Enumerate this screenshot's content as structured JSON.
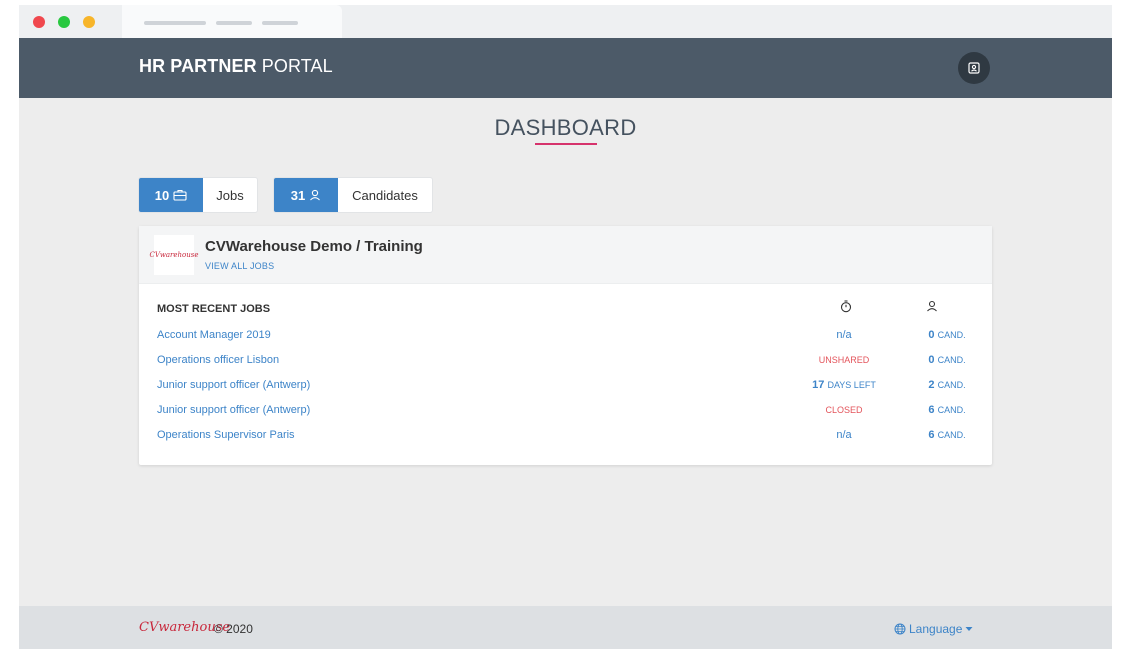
{
  "brand": {
    "bold": "HR PARTNER",
    "rest": " PORTAL"
  },
  "page_title": "DASHBOARD",
  "counters": [
    {
      "value": "10",
      "label": "Jobs",
      "icon": "briefcase-icon"
    },
    {
      "value": "31",
      "label": "Candidates",
      "icon": "user-icon"
    }
  ],
  "company": {
    "name": "CVWarehouse Demo / Training",
    "view_all": "VIEW ALL JOBS",
    "logo_text": "CVwarehouse"
  },
  "jobs": {
    "header": "MOST RECENT JOBS",
    "rows": [
      {
        "title": "Account Manager 2019",
        "status": "n/a",
        "status_type": "na",
        "count": "0",
        "cand_unit": "CAND."
      },
      {
        "title": "Operations officer Lisbon",
        "status": "UNSHARED",
        "status_type": "red",
        "count": "0",
        "cand_unit": "CAND."
      },
      {
        "title": "Junior support officer (Antwerp)",
        "status_num": "17",
        "status": "DAYS LEFT",
        "status_type": "days",
        "count": "2",
        "cand_unit": "CAND."
      },
      {
        "title": "Junior support officer (Antwerp)",
        "status": "CLOSED",
        "status_type": "red",
        "count": "6",
        "cand_unit": "CAND."
      },
      {
        "title": "Operations Supervisor Paris",
        "status": "n/a",
        "status_type": "na",
        "count": "6",
        "cand_unit": "CAND."
      }
    ]
  },
  "footer": {
    "logo_text": "CVwarehouse",
    "copyright": "© 2020",
    "language": "Language"
  },
  "colors": {
    "accent": "#3d84c8",
    "header": "#4c5a68",
    "danger": "#e3545b",
    "underline": "#d6336c"
  }
}
